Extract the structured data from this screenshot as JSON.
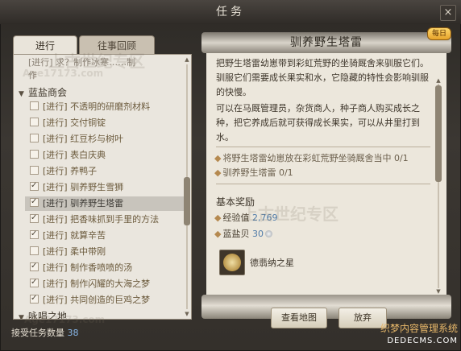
{
  "window": {
    "title": "任务",
    "close_label": "×"
  },
  "tabs": [
    {
      "label": "进行",
      "active": true
    },
    {
      "label": "往事回顾",
      "active": false
    }
  ],
  "quest_list": {
    "cut_off_rows": [
      "[进行] 求？制作冰寒……制",
      "作"
    ],
    "categories": [
      {
        "name": "蓝盐商会",
        "quests": [
          {
            "label": "[进行] 不透明的研磨剂材料",
            "checked": false
          },
          {
            "label": "[进行] 交付铜锭",
            "checked": false
          },
          {
            "label": "[进行] 红豆杉与树叶",
            "checked": false
          },
          {
            "label": "[进行] 表白庆典",
            "checked": false
          },
          {
            "label": "[进行] 养鸭子",
            "checked": false
          },
          {
            "label": "[进行] 驯养野生雪狮",
            "checked": true
          },
          {
            "label": "[进行] 驯养野生塔雷",
            "checked": true,
            "selected": true
          },
          {
            "label": "[进行] 把香味抓到手里的方法",
            "checked": true
          },
          {
            "label": "[进行] 就算辛苦",
            "checked": true
          },
          {
            "label": "[进行] 柔中带刚",
            "checked": false
          },
          {
            "label": "[进行] 制作香喷喷的汤",
            "checked": true
          },
          {
            "label": "[进行] 制作闪耀的大海之梦",
            "checked": true
          },
          {
            "label": "[进行] 共同创造的巨鸡之梦",
            "checked": true
          }
        ]
      },
      {
        "name": "咏唱之地",
        "quests": []
      }
    ]
  },
  "footer": {
    "accepted_label": "接受任务数量",
    "accepted_count": "38"
  },
  "detail": {
    "title": "驯养野生塔雷",
    "daily_badge": "每日",
    "paragraphs": [
      "把野生塔雷幼崽带到彩虹荒野的坐骑厩舍来驯服它们。驯服它们需要成长果实和水，它隐藏的特性会影响驯服的快慢。",
      "可以在马厩管理员，杂货商人，种子商人购买成长之种，把它养成后就可获得成长果实，可以从井里打到水。"
    ],
    "objectives": [
      "将野生塔雷幼崽放在彩虹荒野坐骑厩舍当中 0/1",
      "驯养野生塔雷 0/1"
    ],
    "rewards_title": "基本奖励",
    "rewards": {
      "exp_label": "经验值",
      "exp_value": "2,769",
      "shell_label": "蓝盐贝",
      "shell_value": "30"
    },
    "item_name": "德翡纳之星",
    "buttons": {
      "map": "查看地图",
      "giveup": "放弃"
    }
  },
  "watermarks": {
    "site": "上古世纪专区",
    "url": "Age17173.com",
    "cms_line1": "织梦内容管理系统",
    "cms_line2": "DEDECMS.COM"
  },
  "colors": {
    "selected_row": "#c8c4bc",
    "count_blue": "#88b6e8",
    "reward_blue": "#4f7ba8",
    "badge_gold": "#f0b440"
  }
}
